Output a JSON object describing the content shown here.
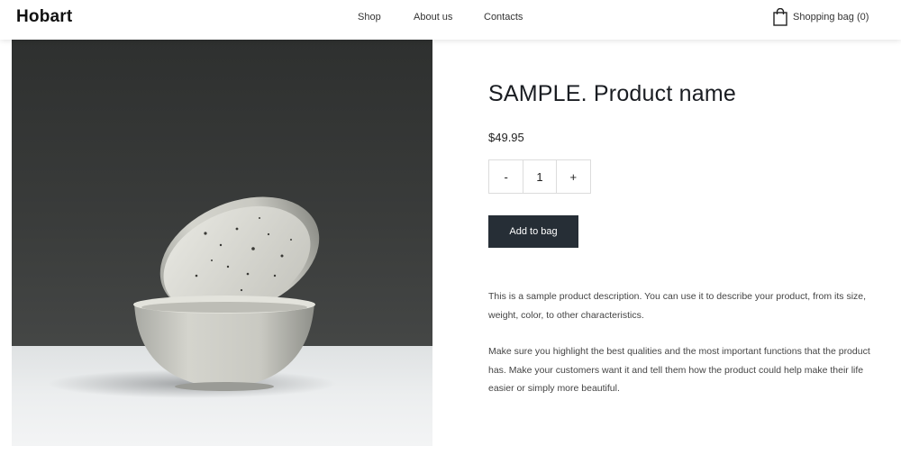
{
  "header": {
    "logo": "Hobart",
    "nav": [
      {
        "label": "Shop"
      },
      {
        "label": "About us"
      },
      {
        "label": "Contacts"
      }
    ],
    "bag": {
      "icon": "shopping-bag-icon",
      "label": "Shopping bag (0)"
    }
  },
  "product": {
    "image": "speckled-ceramic-bowls-photo",
    "title": "SAMPLE. Product name",
    "price": "$49.95",
    "quantity": {
      "decrement_label": "-",
      "value": "1",
      "increment_label": "+"
    },
    "add_to_bag_label": "Add to bag",
    "description": [
      "This is a sample product description. You can use it to describe your product, from its size, weight, color, to other characteristics.",
      "Make sure you highlight the best qualities and the most important functions that the product has. Make your customers want it and tell them how the product could help make their life easier or simply more beautiful."
    ]
  },
  "colors": {
    "button_background": "#262e36",
    "button_text": "#ffffff",
    "photo_backdrop": "#3a3c3b"
  }
}
